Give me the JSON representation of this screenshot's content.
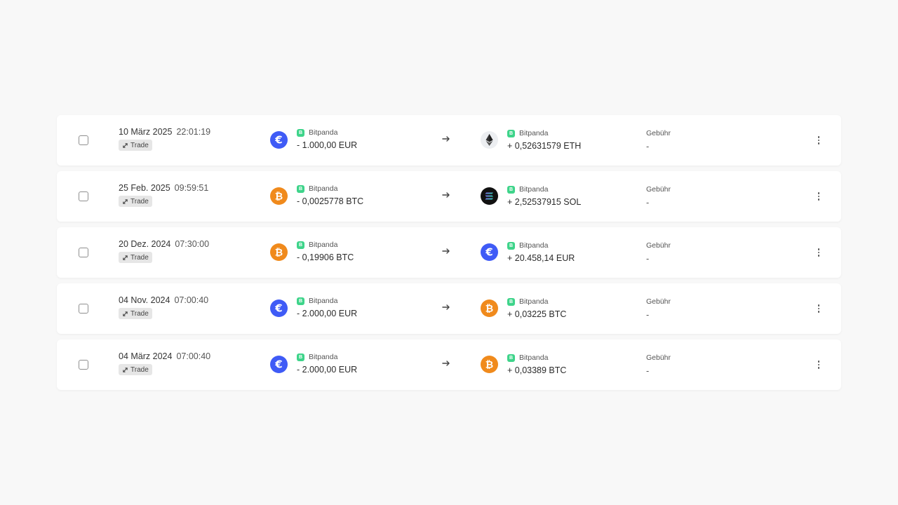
{
  "transactions": [
    {
      "date": "10 März 2025",
      "time": "22:01:19",
      "type": "Trade",
      "from": {
        "icon": "euro-coin-icon",
        "coin": "eur",
        "exchange": "Bitpanda",
        "amount": "- 1.000,00 EUR"
      },
      "to": {
        "icon": "ethereum-coin-icon",
        "coin": "eth",
        "exchange": "Bitpanda",
        "amount": "+ 0,52631579 ETH"
      },
      "fee_label": "Gebühr",
      "fee_value": "-"
    },
    {
      "date": "25 Feb. 2025",
      "time": "09:59:51",
      "type": "Trade",
      "from": {
        "icon": "bitcoin-coin-icon",
        "coin": "btc",
        "exchange": "Bitpanda",
        "amount": "- 0,0025778 BTC"
      },
      "to": {
        "icon": "solana-coin-icon",
        "coin": "sol",
        "exchange": "Bitpanda",
        "amount": "+ 2,52537915 SOL"
      },
      "fee_label": "Gebühr",
      "fee_value": "-"
    },
    {
      "date": "20 Dez. 2024",
      "time": "07:30:00",
      "type": "Trade",
      "from": {
        "icon": "bitcoin-coin-icon",
        "coin": "btc",
        "exchange": "Bitpanda",
        "amount": "- 0,19906 BTC"
      },
      "to": {
        "icon": "euro-coin-icon",
        "coin": "eur",
        "exchange": "Bitpanda",
        "amount": "+ 20.458,14 EUR"
      },
      "fee_label": "Gebühr",
      "fee_value": "-"
    },
    {
      "date": "04 Nov. 2024",
      "time": "07:00:40",
      "type": "Trade",
      "from": {
        "icon": "euro-coin-icon",
        "coin": "eur",
        "exchange": "Bitpanda",
        "amount": "- 2.000,00 EUR"
      },
      "to": {
        "icon": "bitcoin-coin-icon",
        "coin": "btc",
        "exchange": "Bitpanda",
        "amount": "+ 0,03225 BTC"
      },
      "fee_label": "Gebühr",
      "fee_value": "-"
    },
    {
      "date": "04 März 2024",
      "time": "07:00:40",
      "type": "Trade",
      "from": {
        "icon": "euro-coin-icon",
        "coin": "eur",
        "exchange": "Bitpanda",
        "amount": "- 2.000,00 EUR"
      },
      "to": {
        "icon": "bitcoin-coin-icon",
        "coin": "btc",
        "exchange": "Bitpanda",
        "amount": "+ 0,03389 BTC"
      },
      "fee_label": "Gebühr",
      "fee_value": "-"
    }
  ],
  "colors": {
    "euro": "#3f5bf6",
    "bitcoin": "#f08a1c",
    "exchange_badge": "#3ed48a",
    "background": "#f8f8f8"
  }
}
